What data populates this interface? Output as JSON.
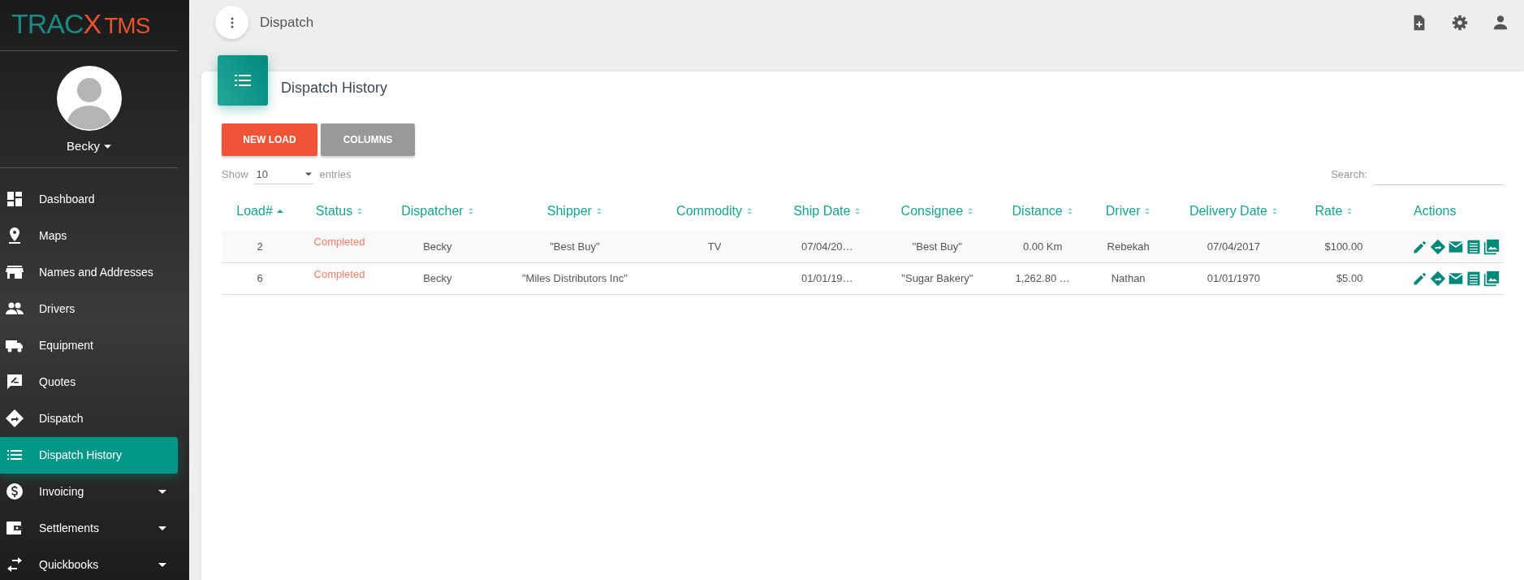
{
  "logo": {
    "parts": [
      {
        "text": "TRAC"
      },
      {
        "text": "X"
      },
      {
        "text": "TMS"
      }
    ]
  },
  "user": {
    "name": "Becky"
  },
  "sidebar": {
    "items": [
      {
        "label": "Dashboard",
        "selected": false,
        "expandable": false
      },
      {
        "label": "Maps",
        "selected": false,
        "expandable": false
      },
      {
        "label": "Names and Addresses",
        "selected": false,
        "expandable": false
      },
      {
        "label": "Drivers",
        "selected": false,
        "expandable": false
      },
      {
        "label": "Equipment",
        "selected": false,
        "expandable": false
      },
      {
        "label": "Quotes",
        "selected": false,
        "expandable": false
      },
      {
        "label": "Dispatch",
        "selected": false,
        "expandable": false
      },
      {
        "label": "Dispatch History",
        "selected": true,
        "expandable": false
      },
      {
        "label": "Invoicing",
        "selected": false,
        "expandable": true
      },
      {
        "label": "Settlements",
        "selected": false,
        "expandable": true
      },
      {
        "label": "Quickbooks",
        "selected": false,
        "expandable": true
      }
    ]
  },
  "topbar": {
    "title": "Dispatch"
  },
  "card": {
    "title": "Dispatch History",
    "buttons": [
      {
        "label": "NEW LOAD",
        "kind": "primary"
      },
      {
        "label": "COLUMNS",
        "kind": "secondary"
      }
    ],
    "length": {
      "before": "Show",
      "value": "10",
      "after": "entries"
    },
    "search": {
      "label": "Search:"
    },
    "table": {
      "columns": [
        {
          "label": "Load#",
          "sorted": true
        },
        {
          "label": "Status",
          "sorted": false
        },
        {
          "label": "Dispatcher",
          "sorted": false
        },
        {
          "label": "Shipper",
          "sorted": false
        },
        {
          "label": "Commodity",
          "sorted": false
        },
        {
          "label": "Ship Date",
          "sorted": false
        },
        {
          "label": "Consignee",
          "sorted": false
        },
        {
          "label": "Distance",
          "sorted": false
        },
        {
          "label": "Driver",
          "sorted": false
        },
        {
          "label": "Delivery Date",
          "sorted": false
        },
        {
          "label": "Rate",
          "sorted": false
        },
        {
          "label": "Actions"
        }
      ],
      "rows": [
        {
          "cells": [
            "2",
            "Completed",
            "Becky",
            "\"Best Buy\"",
            "TV",
            "07/04/20…",
            "\"Best Buy\"",
            "0.00 Km",
            "Rebekah",
            "07/04/2017",
            "$100.00"
          ]
        },
        {
          "cells": [
            "6",
            "Completed",
            "Becky",
            "\"Miles Distributors Inc\"",
            "",
            "01/01/19…",
            "\"Sugar Bakery\"",
            "1,262.80 …",
            "Nathan",
            "01/01/1970",
            "$5.00"
          ]
        }
      ]
    }
  }
}
